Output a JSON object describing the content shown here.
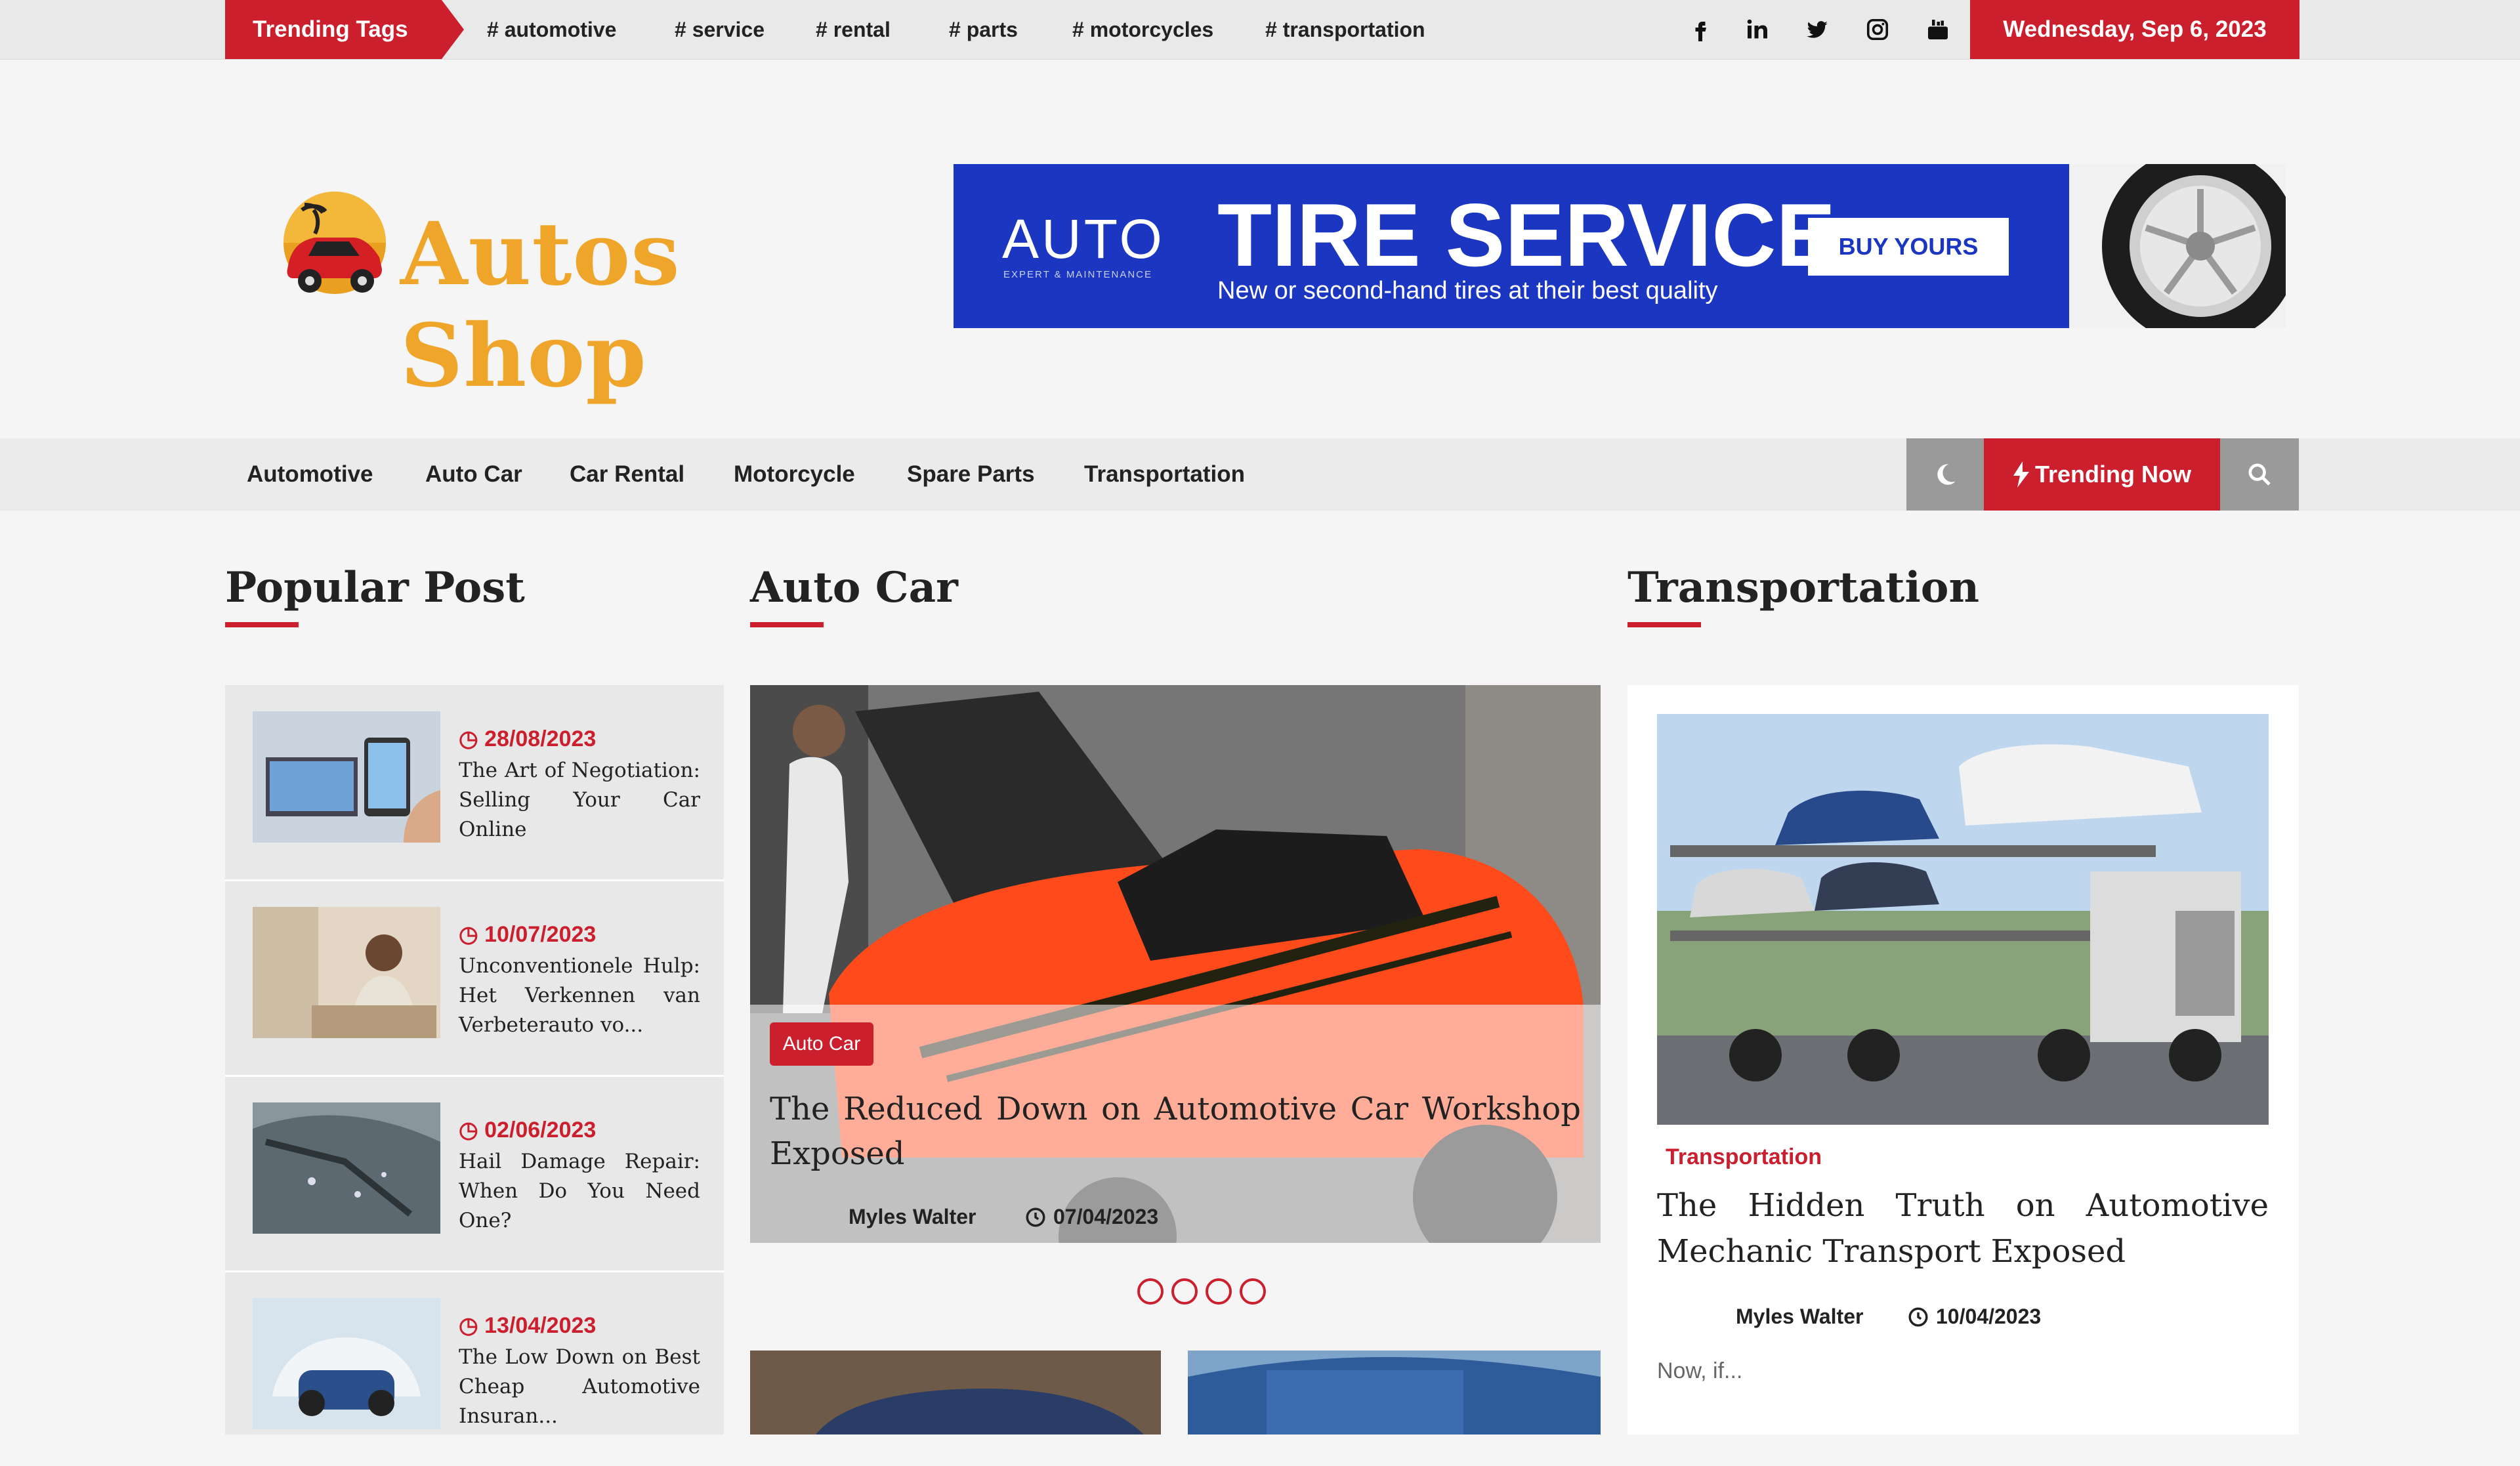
{
  "topbar": {
    "trending_label": "Trending Tags",
    "tags": [
      "# automotive",
      "# service",
      "# rental",
      "# parts",
      "# motorcycles",
      "# transportation"
    ],
    "social": [
      "facebook-icon",
      "linkedin-icon",
      "twitter-icon",
      "instagram-icon",
      "youtube-icon"
    ],
    "date": "Wednesday, Sep 6, 2023"
  },
  "header": {
    "logo_text": "Autos Shop",
    "banner": {
      "brand": "AUTO",
      "brand_sub": "EXPERT & MAINTENANCE",
      "title": "TIRE SERVICE",
      "subtitle": "New or second-hand tires at their best quality",
      "button": "BUY YOURS"
    }
  },
  "nav": {
    "items": [
      "Automotive",
      "Auto Car",
      "Car Rental",
      "Motorcycle",
      "Spare Parts",
      "Transportation"
    ],
    "trending_now": "Trending Now"
  },
  "popular": {
    "title": "Popular Post",
    "posts": [
      {
        "date": "28/08/2023",
        "title": "The Art of Negotiation: Selling Your Car Online"
      },
      {
        "date": "10/07/2023",
        "title": "Unconventionele Hulp: Het Verkennen van Verbeterauto vo..."
      },
      {
        "date": "02/06/2023",
        "title": "Hail Damage Repair: When Do You Need One?"
      },
      {
        "date": "13/04/2023",
        "title": "The Low Down on Best Cheap Automotive Insuran..."
      }
    ]
  },
  "autocar": {
    "title": "Auto Car",
    "slide": {
      "category": "Auto Car",
      "title": "The Reduced Down on Automotive Car Workshop Exposed",
      "author": "Myles Walter",
      "date": "07/04/2023"
    }
  },
  "transportation": {
    "title": "Transportation",
    "category": "Transportation",
    "post_title": "The Hidden Truth on Automotive Mechanic Transport Exposed",
    "author": "Myles Walter",
    "date": "10/04/2023",
    "excerpt": "Now, if..."
  },
  "colors": {
    "accent": "#cc1f2e",
    "logo": "#eea52a",
    "banner": "#1b37c2"
  }
}
